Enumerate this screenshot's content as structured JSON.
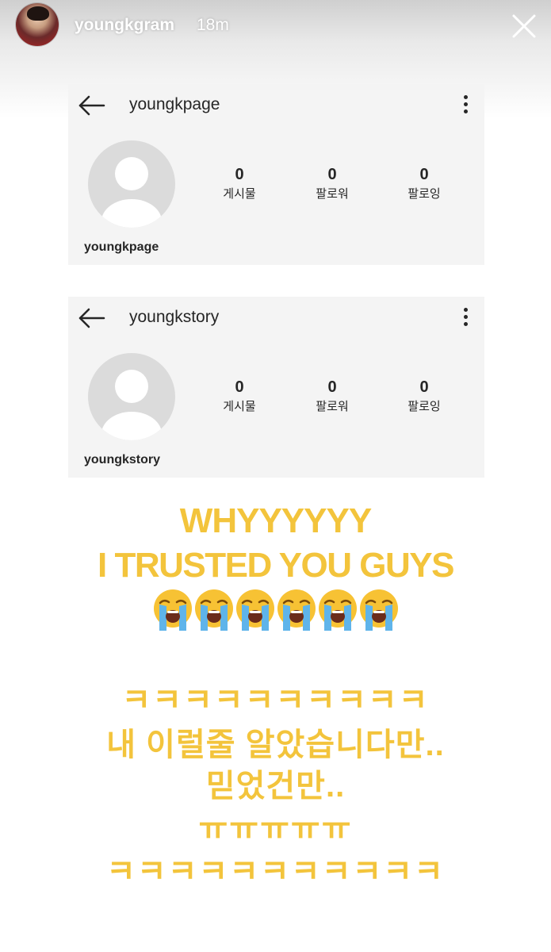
{
  "story": {
    "username": "youngkgram",
    "time": "18m"
  },
  "cards": [
    {
      "header_username": "youngkpage",
      "profile_username": "youngkpage",
      "posts": {
        "count": "0",
        "label": "게시물"
      },
      "followers": {
        "count": "0",
        "label": "팔로워"
      },
      "following": {
        "count": "0",
        "label": "팔로잉"
      }
    },
    {
      "header_username": "youngkstory",
      "profile_username": "youngkstory",
      "posts": {
        "count": "0",
        "label": "게시물"
      },
      "followers": {
        "count": "0",
        "label": "팔로워"
      },
      "following": {
        "count": "0",
        "label": "팔로잉"
      }
    }
  ],
  "caption": {
    "line1": "WHYYYYYY",
    "line2": "I TRUSTED YOU GUYS",
    "emoji": "loudly-crying-face",
    "emoji_count": 6,
    "line3": "ㅋㅋㅋㅋㅋㅋㅋㅋㅋㅋ",
    "line4": "내 이럴줄 알았습니다만..",
    "line5": "믿었건만..",
    "line6": "ㅠㅠㅠㅠㅠ",
    "line7": "ㅋㅋㅋㅋㅋㅋㅋㅋㅋㅋㅋ"
  },
  "colors": {
    "caption_text": "#f3c43c",
    "card_background": "#f4f4f4",
    "avatar_placeholder": "#dbdbdb"
  }
}
